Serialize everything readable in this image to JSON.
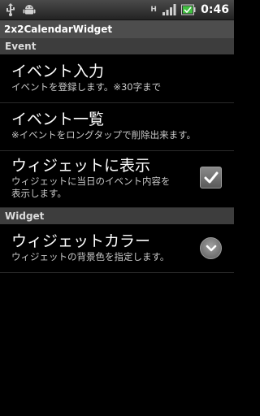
{
  "status_bar": {
    "signal_type": "H",
    "time": "0:46"
  },
  "app": {
    "title": "2x2CalendarWidget"
  },
  "sections": [
    {
      "header": "Event",
      "items": [
        {
          "title": "イベント入力",
          "summary": "イベントを登録します。※30字まで"
        },
        {
          "title": "イベント一覧",
          "summary": "※イベントをロングタップで削除出来ます。"
        },
        {
          "title": "ウィジェットに表示",
          "summary_line1": "ウィジェットに当日のイベント内容を",
          "summary_line2": "表示します。",
          "checked": true
        }
      ]
    },
    {
      "header": "Widget",
      "items": [
        {
          "title": "ウィジェットカラー",
          "summary": "ウィジェットの背景色を指定します。"
        }
      ]
    }
  ],
  "colors": {
    "background": "#000000",
    "title_bar": "#4d4d4d",
    "section_header": "#3d3d3d",
    "battery": "#3fbf3f"
  },
  "icons": [
    "usb-icon",
    "android-icon",
    "signal-icon",
    "battery-icon",
    "check-icon",
    "chevron-down-icon"
  ]
}
